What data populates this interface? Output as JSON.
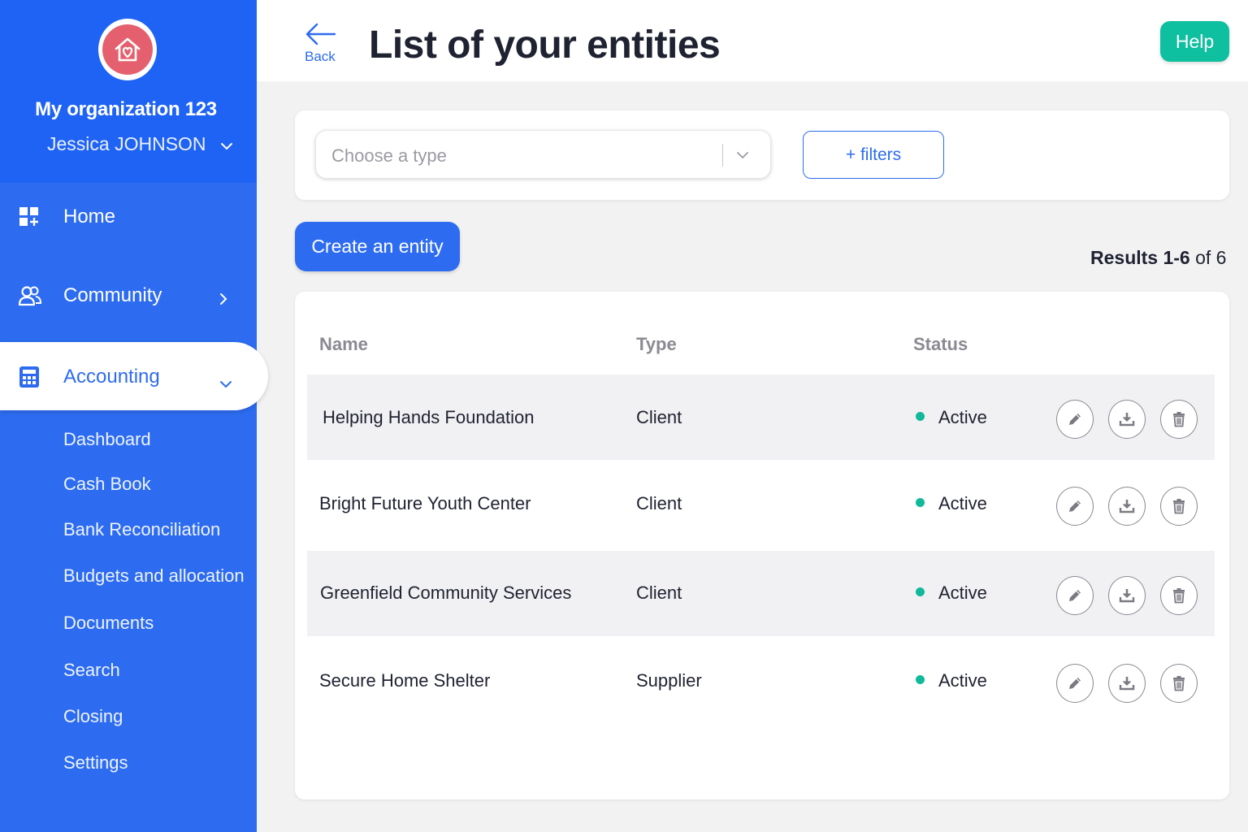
{
  "sidebar": {
    "org_name": "My organization 123",
    "user_name": "Jessica JOHNSON",
    "nav": [
      {
        "label": "Home",
        "icon": "dashboard-grid-icon"
      },
      {
        "label": "Community",
        "icon": "users-icon"
      },
      {
        "label": "Accounting",
        "icon": "calculator-icon",
        "active": true
      }
    ],
    "sub_items": [
      {
        "label": "Dashboard"
      },
      {
        "label": "Cash Book"
      },
      {
        "label": "Bank Reconciliation"
      },
      {
        "label": "Budgets and allocation"
      },
      {
        "label": "Documents"
      },
      {
        "label": "Search"
      },
      {
        "label": "Closing"
      },
      {
        "label": "Settings"
      }
    ]
  },
  "header": {
    "back_label": "Back",
    "title": "List of your entities",
    "help_label": "Help"
  },
  "filters": {
    "type_placeholder": "Choose a type",
    "filters_label": "+ filters"
  },
  "toolbar": {
    "create_label": "Create an entity",
    "results_range": "Results 1-6",
    "results_total": " of 6"
  },
  "table": {
    "headers": [
      "Name",
      "Type",
      "Status"
    ],
    "rows": [
      {
        "name": "Helping Hands Foundation",
        "type": "Client",
        "status": "Active"
      },
      {
        "name": "Bright Future Youth Center",
        "type": "Client",
        "status": "Active"
      },
      {
        "name": "Greenfield Community Services",
        "type": "Client",
        "status": "Active"
      },
      {
        "name": "Secure Home Shelter",
        "type": "Supplier",
        "status": "Active"
      }
    ]
  },
  "colors": {
    "sidebar_bg": "#2d6cf0",
    "accent": "#2d6cf0",
    "help": "#0fc0a0",
    "status_active": "#10b99a",
    "logo": "#e5606e"
  }
}
